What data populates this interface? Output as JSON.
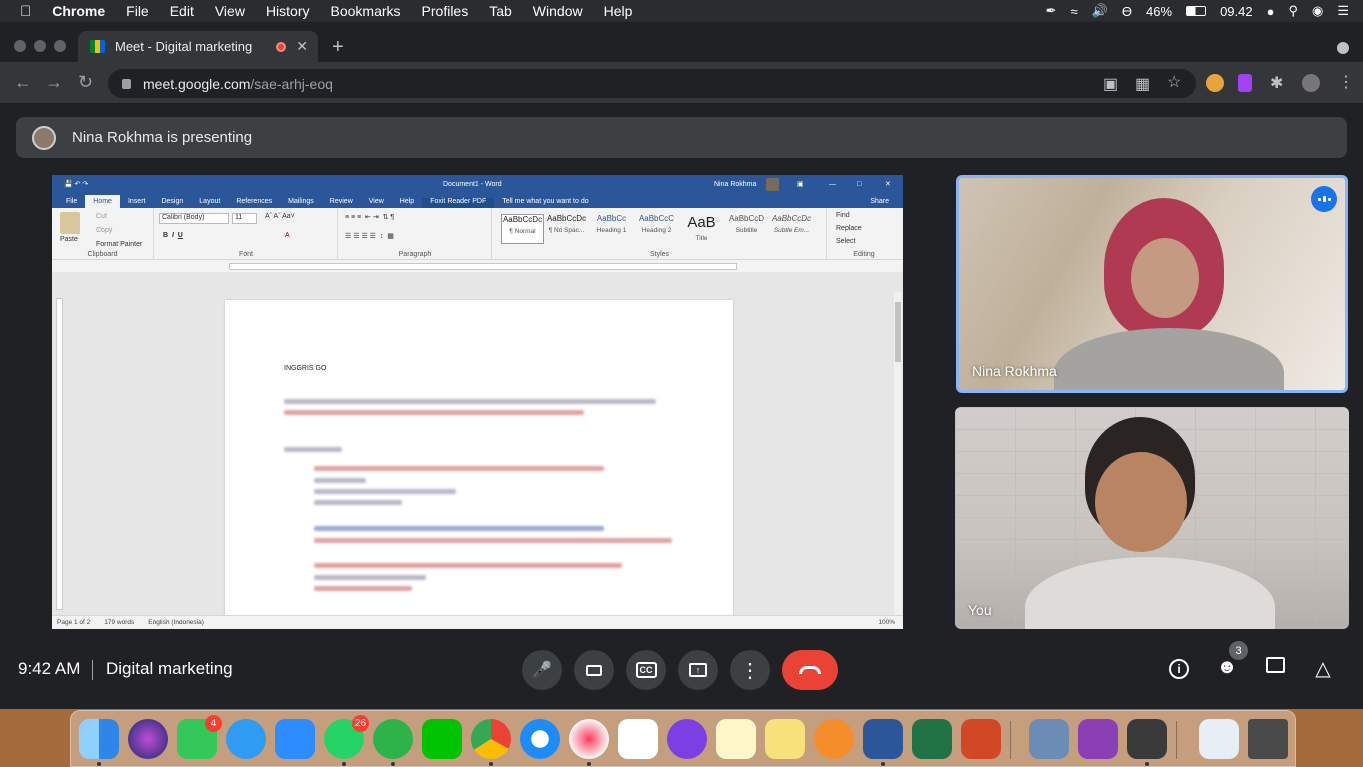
{
  "menubar": {
    "apple": "",
    "app": "Chrome",
    "items": [
      "File",
      "Edit",
      "View",
      "History",
      "Bookmarks",
      "Profiles",
      "Tab",
      "Window",
      "Help"
    ],
    "battery": "46%",
    "time": "09.42"
  },
  "browser": {
    "tab_title": "Meet - Digital marketing",
    "new_tab": "+",
    "url_host": "meet.google.com",
    "url_path": "/sae-arhj-eoq"
  },
  "presenting": {
    "text": "Nina Rokhma is presenting"
  },
  "word": {
    "title": "Document1 - Word",
    "user": "Nina Rokhma",
    "tabs": [
      "File",
      "Home",
      "Insert",
      "Design",
      "Layout",
      "References",
      "Mailings",
      "Review",
      "View",
      "Help",
      "Foxit Reader PDF",
      "Tell me what you want to do"
    ],
    "share": "Share",
    "clipboard": {
      "paste": "Paste",
      "cut": "Cut",
      "copy": "Copy",
      "format_painter": "Format Painter",
      "label": "Clipboard"
    },
    "font": {
      "name": "Calibri (Body)",
      "size": "11",
      "label": "Font"
    },
    "paragraph_label": "Paragraph",
    "styles": [
      {
        "preview": "AaBbCcDc",
        "name": "¶ Normal"
      },
      {
        "preview": "AaBbCcDc",
        "name": "¶ No Spac..."
      },
      {
        "preview": "AaBbCc",
        "name": "Heading 1"
      },
      {
        "preview": "AaBbCcC",
        "name": "Heading 2"
      },
      {
        "preview": "AaB",
        "name": "Title"
      },
      {
        "preview": "AaBbCcD",
        "name": "Subtitle"
      },
      {
        "preview": "AaBbCcDc",
        "name": "Subtle Em..."
      }
    ],
    "styles_label": "Styles",
    "editing": {
      "find": "Find",
      "replace": "Replace",
      "select": "Select",
      "label": "Editing"
    },
    "doc_heading": "INGGRIS GO",
    "status": {
      "page": "Page 1 of 2",
      "words": "179 words",
      "language": "English (Indonesia)",
      "zoom": "100%"
    }
  },
  "participants": [
    {
      "name": "Nina Rokhma",
      "speaking": true
    },
    {
      "name": "You",
      "speaking": false
    }
  ],
  "controls": {
    "time": "9:42 AM",
    "meeting_name": "Digital marketing",
    "people_count": "3"
  },
  "dock": {
    "facetime_badge": "4",
    "whatsapp_badge": "26"
  },
  "colors": {
    "meet_bg": "#202124",
    "accent": "#8ab4f8",
    "end_call": "#ea4335",
    "word_blue": "#2b579a"
  }
}
